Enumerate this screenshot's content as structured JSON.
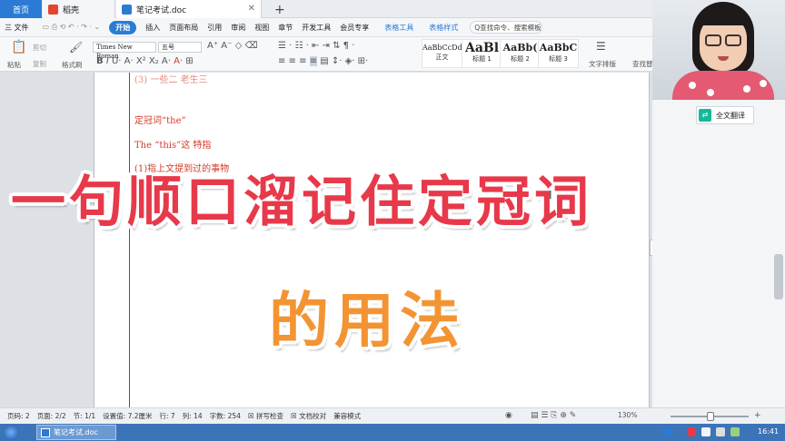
{
  "tabs": {
    "home": "首页",
    "daoke": "稻壳",
    "doc": "笔记考试.doc",
    "new_tab": "+"
  },
  "menu": {
    "file": "三 文件",
    "start": "开始",
    "items": [
      "插入",
      "页面布局",
      "引用",
      "审阅",
      "视图",
      "章节",
      "开发工具",
      "会员专享"
    ],
    "table_tools": "表格工具",
    "table_style": "表格样式",
    "search_placeholder": "Q查找命令、搜索模板"
  },
  "ribbon": {
    "paste": "粘贴",
    "cut": "剪切",
    "copy": "复制",
    "format_painter": "格式刷",
    "font_name": "Times New Roman",
    "font_size": "五号",
    "styles": [
      {
        "sample": "AaBbCcDd",
        "name": "正文"
      },
      {
        "sample": "AaBl",
        "name": "标题 1"
      },
      {
        "sample": "AaBb(",
        "name": "标题 2"
      },
      {
        "sample": "AaBbC",
        "name": "标题 3"
      }
    ],
    "text_layout": "文字排版",
    "find_replace": "查找替"
  },
  "document": {
    "line_partial": "(3) 一些二 老生三",
    "line1": "定冠词“the”",
    "line2": "The “this”这  特指",
    "line3": "(1)指上文提到过的事物"
  },
  "overlay": {
    "line1": "一句顺口溜记住定冠词",
    "line2": "的用法"
  },
  "side_panel": {
    "translate": "全文翻译"
  },
  "status": {
    "page_no": "页码: 2",
    "pages": "页面: 2/2",
    "section": "节: 1/1",
    "setting": "设置值: 7.2厘米",
    "row": "行: 7",
    "col": "列: 14",
    "words": "字数: 254",
    "spell": "拼写检查",
    "proof": "文档校对",
    "compat": "兼容模式",
    "zoom": "130%"
  },
  "taskbar": {
    "app": "笔记考试.doc",
    "time": "16:41"
  },
  "colors": {
    "accent": "#2b7bd4",
    "doc_text": "#d23b2a",
    "overlay1": "#e7394a",
    "overlay2": "#f39434",
    "translate_badge": "#16b89a"
  }
}
